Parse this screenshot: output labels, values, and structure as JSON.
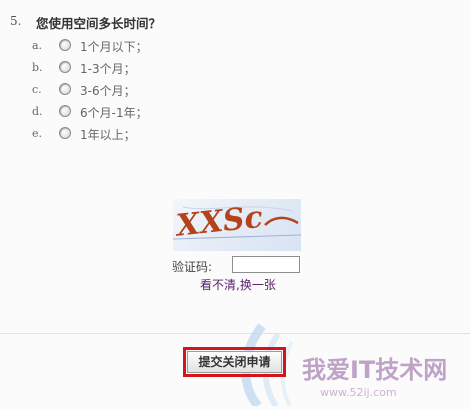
{
  "question": {
    "number": "5.",
    "title": "您使用空间多长时间？",
    "options": [
      {
        "letter": "a.",
        "label": "1个月以下；"
      },
      {
        "letter": "b.",
        "label": "1-3个月；"
      },
      {
        "letter": "c.",
        "label": "3-6个月；"
      },
      {
        "letter": "d.",
        "label": "6个月-1年；"
      },
      {
        "letter": "e.",
        "label": "1年以上；"
      }
    ]
  },
  "captcha": {
    "image_text": "XXSc",
    "label": "验证码:",
    "value": "",
    "refresh_link": "看不清,换一张"
  },
  "submit": {
    "label": "提交关闭申请"
  },
  "watermark": {
    "text": "我爱IT技术网",
    "url": "www.52ij.com"
  },
  "colors": {
    "highlight_border": "#d3151b",
    "captcha_text": "#b4431b",
    "link": "#5a1f6b",
    "watermark_text": "#8d5c9e"
  }
}
